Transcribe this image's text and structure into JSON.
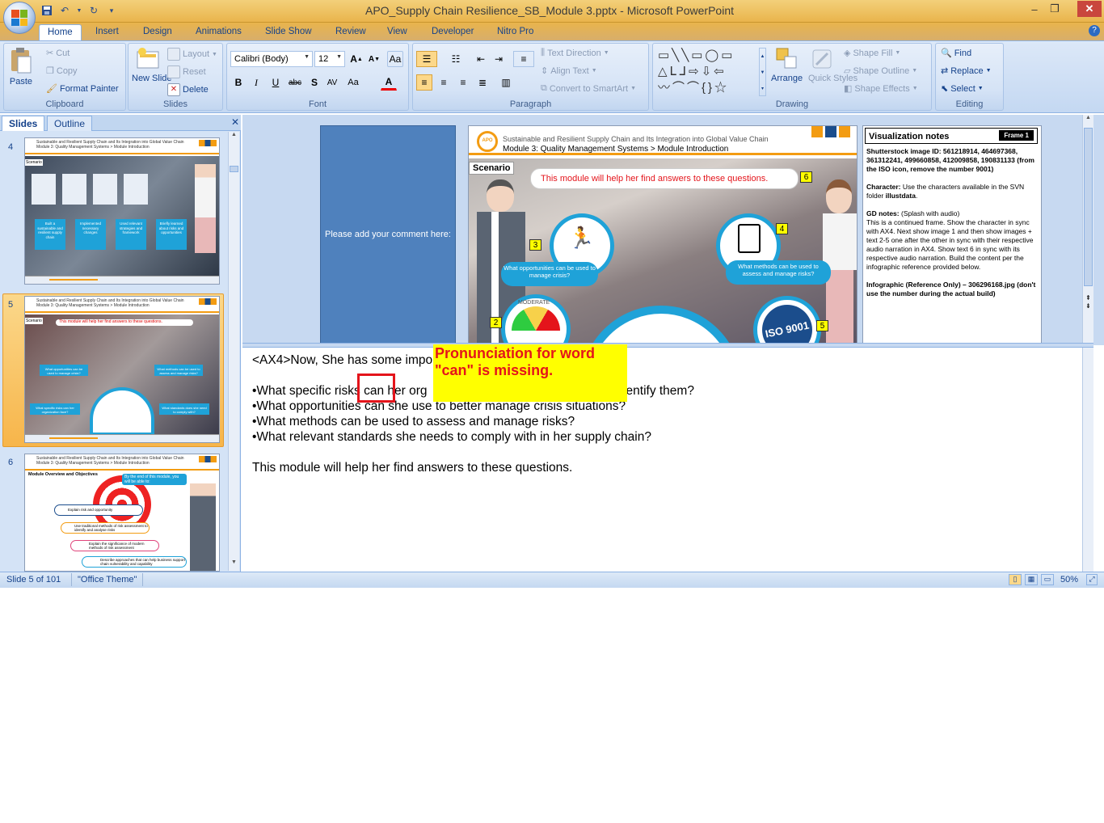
{
  "window": {
    "title": "APO_Supply Chain Resilience_SB_Module 3.pptx - Microsoft PowerPoint",
    "minimize": "–",
    "restore": "❐",
    "close": "✕"
  },
  "ribbon_tabs": [
    "Home",
    "Insert",
    "Design",
    "Animations",
    "Slide Show",
    "Review",
    "View",
    "Developer",
    "Nitro Pro"
  ],
  "clipboard": {
    "paste": "Paste",
    "cut": "Cut",
    "copy": "Copy",
    "format_painter": "Format Painter",
    "label": "Clipboard"
  },
  "slides_group": {
    "new_slide": "New Slide",
    "layout": "Layout",
    "reset": "Reset",
    "delete": "Delete",
    "label": "Slides"
  },
  "font": {
    "name": "Calibri (Body)",
    "size": "12",
    "label": "Font"
  },
  "paragraph": {
    "text_direction": "Text Direction",
    "align_text": "Align Text",
    "convert_smartart": "Convert to SmartArt",
    "label": "Paragraph"
  },
  "drawing": {
    "arrange": "Arrange",
    "quick_styles": "Quick Styles",
    "shape_fill": "Shape Fill",
    "shape_outline": "Shape Outline",
    "shape_effects": "Shape Effects",
    "label": "Drawing"
  },
  "editing": {
    "find": "Find",
    "replace": "Replace",
    "select": "Select",
    "label": "Editing"
  },
  "left_pane": {
    "tab_slides": "Slides",
    "tab_outline": "Outline",
    "slide_numbers": [
      "4",
      "5",
      "6"
    ]
  },
  "thumb_common": {
    "header_line1": "Sustainable and Resilient Supply Chain and Its Integration into Global Value Chain",
    "header_line2": "Module 3: Quality Management Systems > Module Introduction"
  },
  "thumb4": {
    "scenario": "Scenario",
    "cards": [
      "Built a sustainable and resilient supply chain",
      "Implemented necessary changes",
      "Used relevant strategies and framework",
      "Briefly learned about risks and opportunities"
    ],
    "badges": [
      "2",
      "3",
      "4",
      "5",
      "1"
    ]
  },
  "thumb5": {
    "scenario": "Scenario",
    "banner": "This module will help her find answers to these questions.",
    "q_left_top": "What opportunities can be used to manage crisis?",
    "q_right_top": "What methods can be used to assess and manage risks?",
    "q_left_bottom": "What specific risks can her organization face?",
    "q_right_bottom": "What standards does she need to comply with?"
  },
  "thumb6": {
    "title": "Module Overview and Objectives",
    "bubble": "By the end of this module, you will be able to:",
    "items": [
      "Explain risk and opportunity",
      "Use traditional methods of risk assessment to identify and analyse risks",
      "Explain the significance of modern methods of risk assessment",
      "Describe approaches that can help business support chain vulnerability and capability"
    ]
  },
  "comment_panel": {
    "text": "Please add your comment here:"
  },
  "main_slide": {
    "header_line1": "Sustainable and Resilient Supply Chain and Its Integration into Global Value Chain",
    "header_line2": "Module 3: Quality Management Systems > Module Introduction",
    "scenario": "Scenario",
    "banner": "This module will help her find answers to these questions.",
    "q_left": "What opportunities can be used to manage crisis?",
    "q_right": "What methods can be used to assess and manage risks?",
    "gauge_label": "MODERATE",
    "iso_text": "ISO 9001",
    "badges": {
      "b6": "6",
      "b3": "3",
      "b4": "4",
      "b2": "2",
      "b5": "5"
    }
  },
  "viz_notes": {
    "title": "Visualization notes",
    "frame": "Frame 1",
    "shutterstock_label": "Shutterstock image ID: 561218914, 464697368, 361312241, 499660858, 412009858, 190831133 (from the ISO icon, remove the number 9001)",
    "character_label": "Character:",
    "character_text": " Use the characters available in the SVN folder ",
    "character_folder": "illustdata",
    "character_end": ".",
    "gd_label": "GD notes:",
    "gd_mode": " (Splash with audio)",
    "gd_text": "This is a continued frame. Show the character in sync with AX4. Next show image 1 and then show images + text 2-5 one after the other in sync with their respective audio narration in AX4. Show text 6 in sync with its respective audio narration. Build the content per the infographic reference provided below.",
    "infographic": "Infographic (Reference Only) – 306296168.jpg (don't use the number during the actual build)"
  },
  "notes": {
    "line1": "<AX4>Now, She has some impo",
    "q1_part1": "•What specific risks",
    "q1_can": "can",
    "q1_part2": "her",
    "q1_part3": "org",
    "q1_end": "entify them?",
    "q2": "•What opportunities can she use  to better manage crisis situations?",
    "q3": "•What methods can be used  to assess and manage risks?",
    "q4": "•What relevant standards she needs  to comply with in her supply chain?",
    "closing": "This module will help her  find answers to these questions."
  },
  "callout": {
    "text": "Pronunciation for word \"can\" is missing."
  },
  "status": {
    "slide": "Slide 5 of 101",
    "theme": "\"Office Theme\"",
    "zoom": "50%"
  },
  "colors": {
    "accent": "#1fa2d8",
    "callout_bg": "#ffff00",
    "callout_text": "#e4141b",
    "comment_bg": "#4f81bd"
  }
}
